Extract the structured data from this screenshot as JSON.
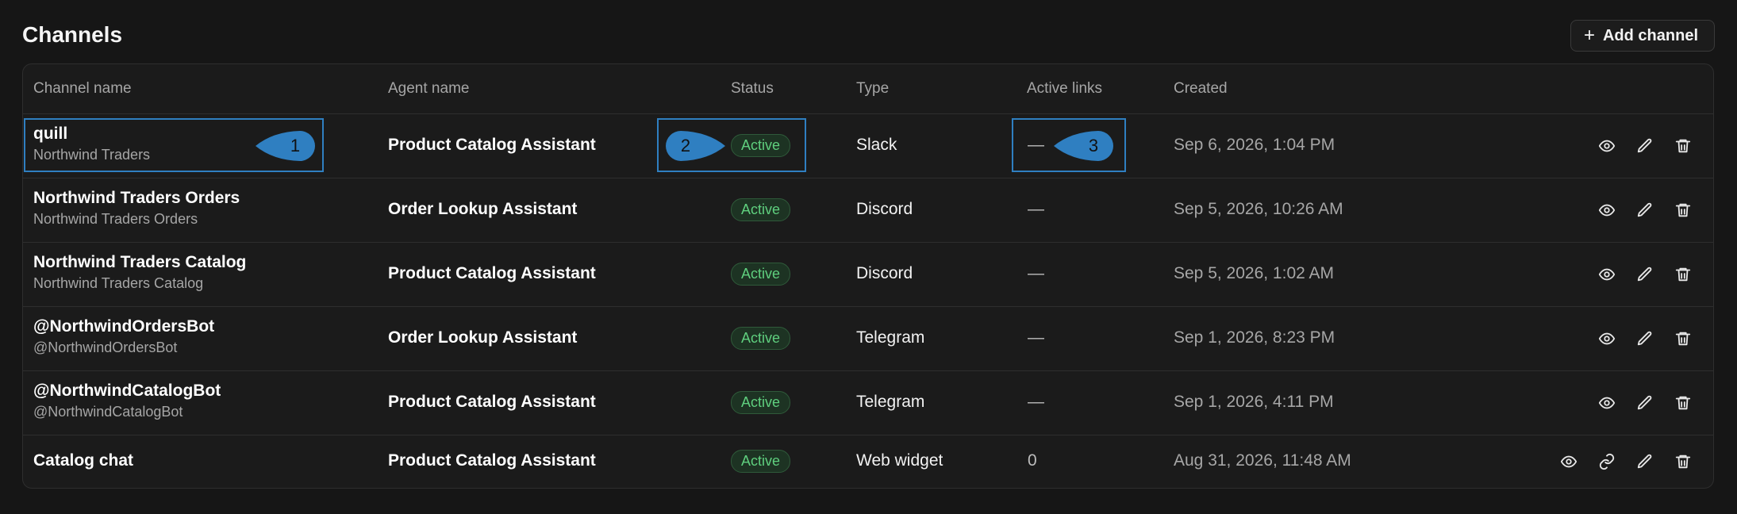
{
  "page": {
    "title": "Channels",
    "add_button": "Add channel"
  },
  "table": {
    "headers": [
      "Channel name",
      "Agent name",
      "Status",
      "Type",
      "Active links",
      "Created"
    ],
    "rows": [
      {
        "name": "quill",
        "sub": "Northwind Traders",
        "agent": "Product Catalog Assistant",
        "status": "Active",
        "type": "Slack",
        "links": "—",
        "created": "Sep 6, 2026, 1:04 PM",
        "actions": [
          "eye-icon",
          "pencil-icon",
          "trash-icon"
        ]
      },
      {
        "name": "Northwind Traders Orders",
        "sub": "Northwind Traders Orders",
        "agent": "Order Lookup Assistant",
        "status": "Active",
        "type": "Discord",
        "links": "—",
        "created": "Sep 5, 2026, 10:26 AM",
        "actions": [
          "eye-icon",
          "pencil-icon",
          "trash-icon"
        ]
      },
      {
        "name": "Northwind Traders Catalog",
        "sub": "Northwind Traders Catalog",
        "agent": "Product Catalog Assistant",
        "status": "Active",
        "type": "Discord",
        "links": "—",
        "created": "Sep 5, 2026, 1:02 AM",
        "actions": [
          "eye-icon",
          "pencil-icon",
          "trash-icon"
        ]
      },
      {
        "name": "@NorthwindOrdersBot",
        "sub": "@NorthwindOrdersBot",
        "agent": "Order Lookup Assistant",
        "status": "Active",
        "type": "Telegram",
        "links": "—",
        "created": "Sep 1, 2026, 8:23 PM",
        "actions": [
          "eye-icon",
          "pencil-icon",
          "trash-icon"
        ]
      },
      {
        "name": "@NorthwindCatalogBot",
        "sub": "@NorthwindCatalogBot",
        "agent": "Product Catalog Assistant",
        "status": "Active",
        "type": "Telegram",
        "links": "—",
        "created": "Sep 1, 2026, 4:11 PM",
        "actions": [
          "eye-icon",
          "pencil-icon",
          "trash-icon"
        ]
      },
      {
        "name": "Catalog chat",
        "sub": "",
        "agent": "Product Catalog Assistant",
        "status": "Active",
        "type": "Web widget",
        "links": "0",
        "created": "Aug 31, 2026, 11:48 AM",
        "actions": [
          "eye-icon",
          "link-icon",
          "pencil-icon",
          "trash-icon"
        ]
      }
    ]
  },
  "annotations": {
    "markers": [
      "1",
      "2",
      "3"
    ],
    "color": "#2f7fc1"
  },
  "colors": {
    "active_badge_text": "#5fcf7e",
    "active_badge_bg": "#1d3323",
    "background": "#161616"
  }
}
